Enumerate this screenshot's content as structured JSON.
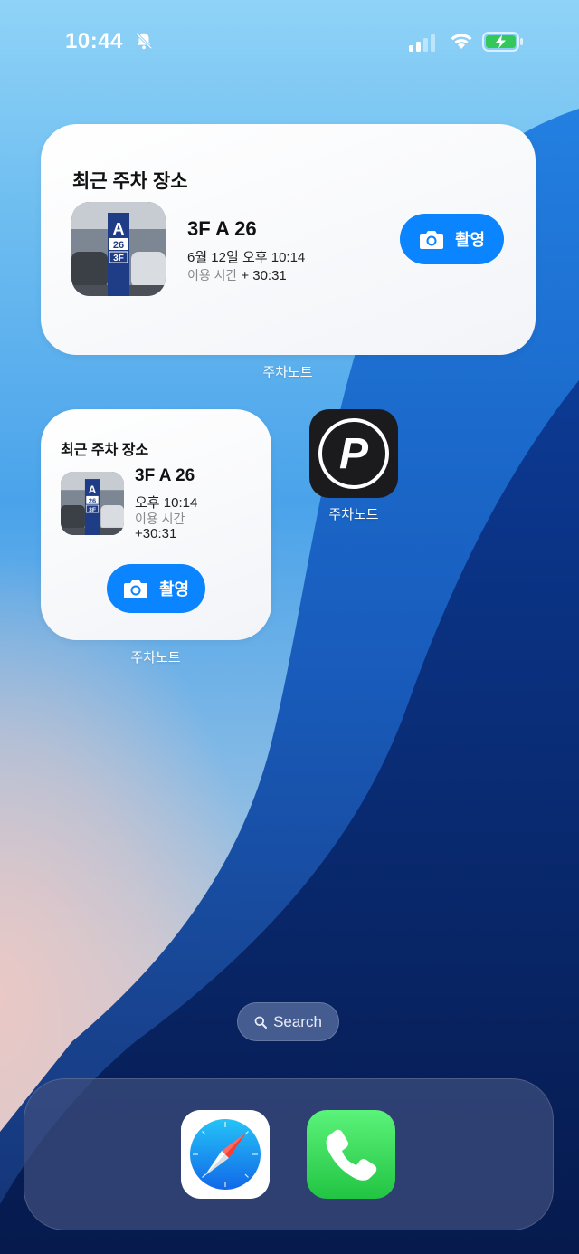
{
  "status_bar": {
    "time": "10:44",
    "icons": [
      "bell-slash-icon",
      "cellular-signal-icon",
      "wifi-icon",
      "battery-charging-icon"
    ]
  },
  "widget_large": {
    "title": "최근 주차 장소",
    "spot": "3F A 26",
    "datetime": "6월 12일 오후 10:14",
    "usage_label": "이용 시간",
    "usage_duration": "+ 30:31",
    "button_label": "촬영",
    "app_label": "주차노트"
  },
  "widget_small": {
    "title": "최근 주차 장소",
    "spot": "3F A 26",
    "datetime": "오후 10:14",
    "usage_label": "이용 시간",
    "usage_duration": "+30:31",
    "button_label": "촬영",
    "app_label": "주차노트"
  },
  "app_icon": {
    "label": "주차노트",
    "glyph": "P",
    "icon": "parking-app-icon"
  },
  "search": {
    "label": "Search",
    "icon": "magnifier-icon"
  },
  "dock": {
    "apps": [
      {
        "name": "Safari",
        "icon": "safari-compass-icon"
      },
      {
        "name": "Phone",
        "icon": "phone-handset-icon"
      }
    ]
  },
  "colors": {
    "accent": "#0a84ff",
    "battery": "#34c759"
  }
}
